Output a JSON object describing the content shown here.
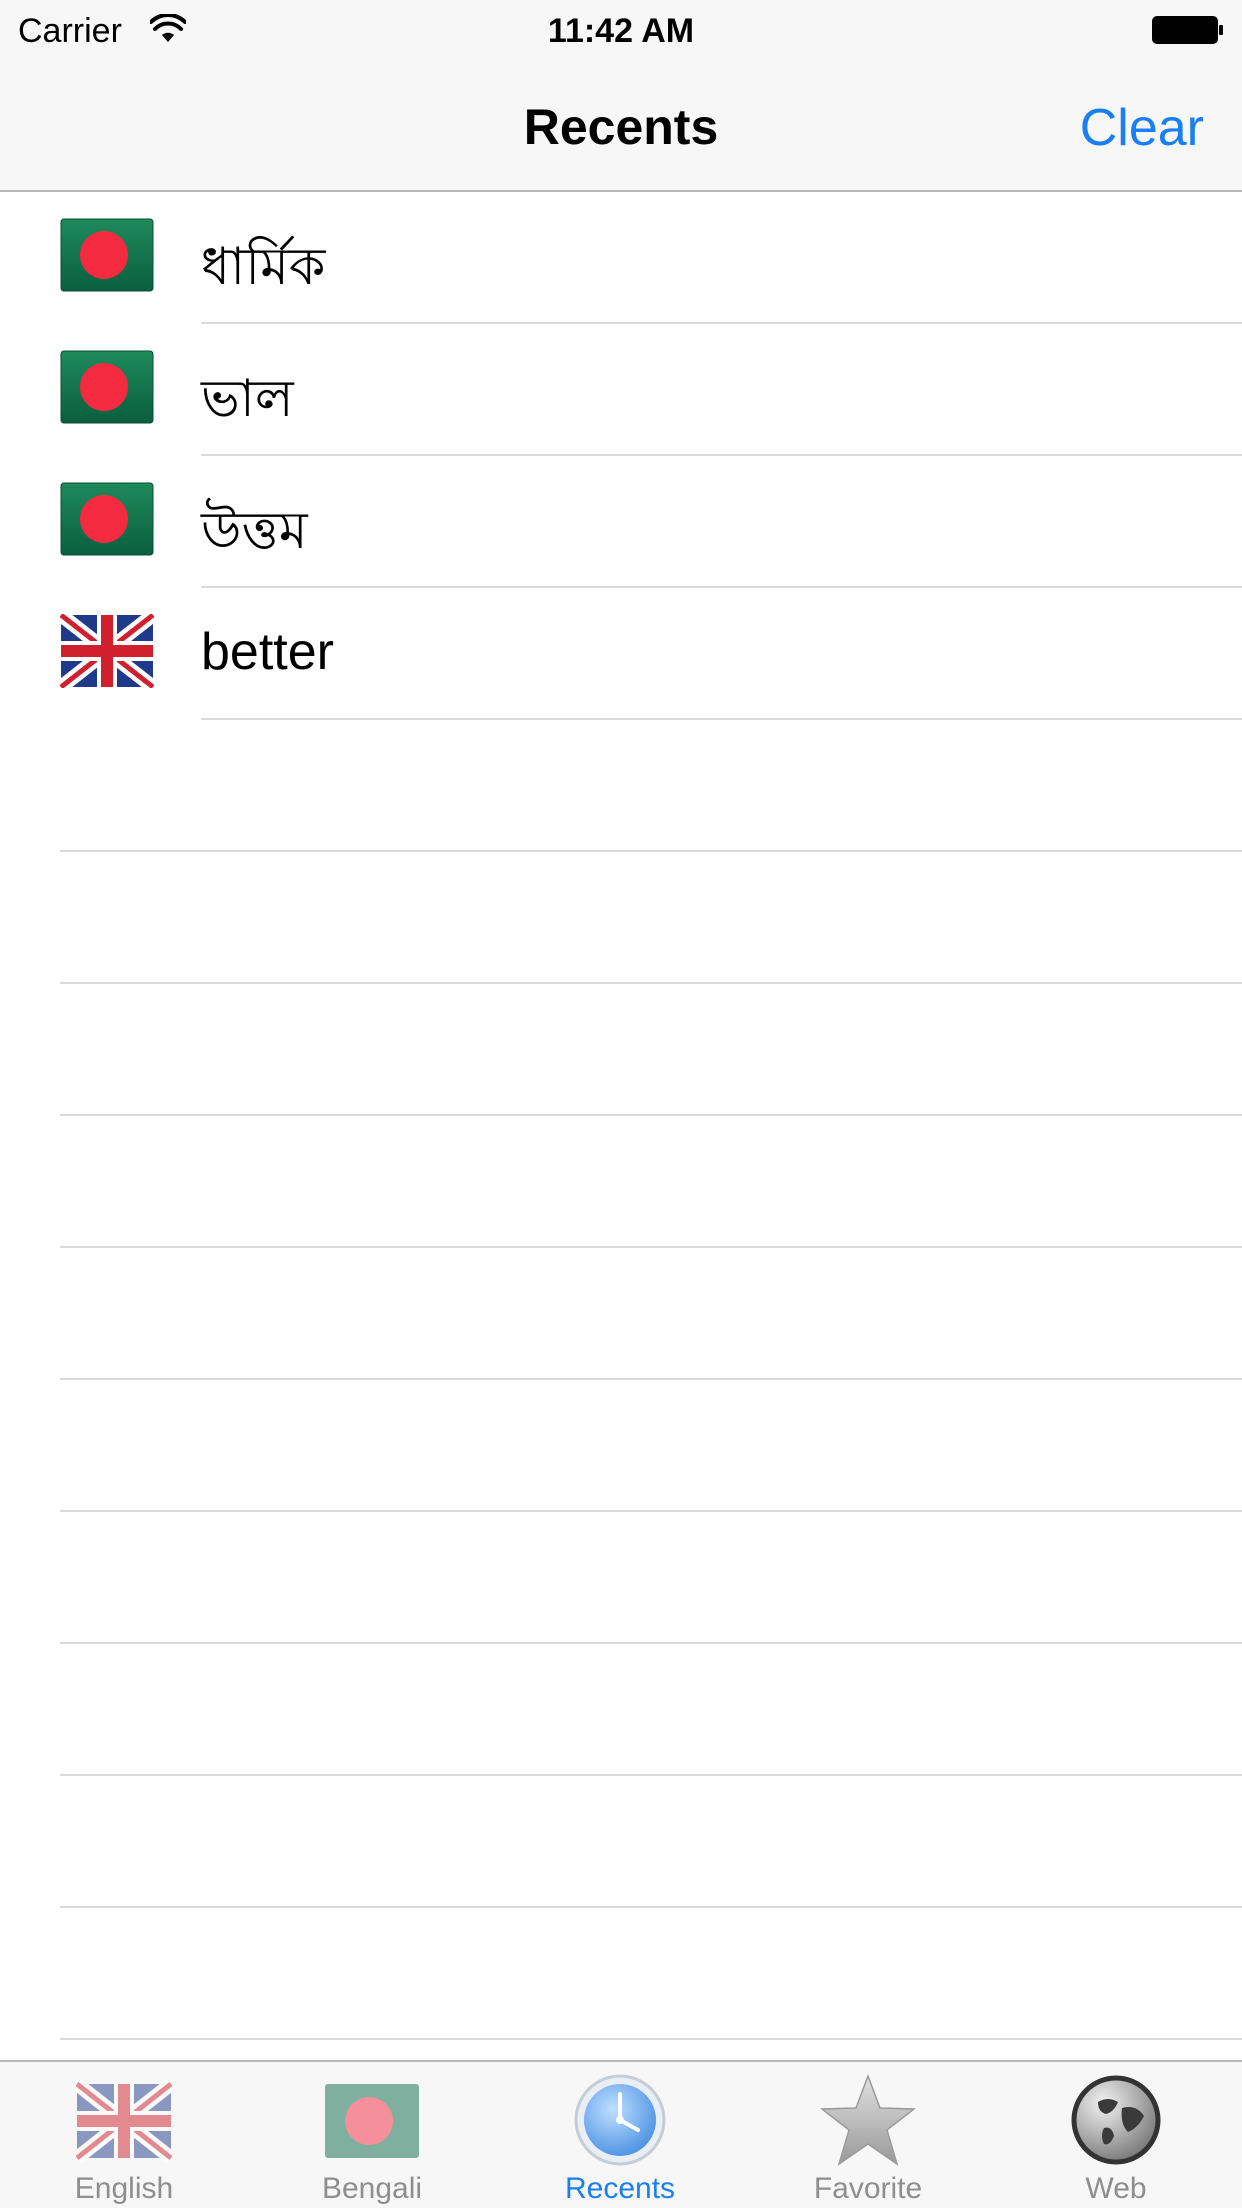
{
  "status_bar": {
    "carrier": "Carrier",
    "time": "11:42 AM"
  },
  "nav": {
    "title": "Recents",
    "clear_label": "Clear"
  },
  "recents": [
    {
      "word": "ধার্মিক",
      "flag": "bangladesh-flag-icon"
    },
    {
      "word": "ভাল",
      "flag": "bangladesh-flag-icon"
    },
    {
      "word": "উত্তম",
      "flag": "bangladesh-flag-icon"
    },
    {
      "word": "better",
      "flag": "uk-flag-icon"
    }
  ],
  "tabs": [
    {
      "label": "English",
      "icon": "uk-flag-icon",
      "active": false
    },
    {
      "label": "Bengali",
      "icon": "bangladesh-flag-icon",
      "active": false
    },
    {
      "label": "Recents",
      "icon": "clock-icon",
      "active": true
    },
    {
      "label": "Favorite",
      "icon": "star-icon",
      "active": false
    },
    {
      "label": "Web",
      "icon": "globe-icon",
      "active": false
    }
  ],
  "colors": {
    "accent": "#1a7ff0",
    "inactive_tab": "#8e8e8e",
    "bar_background": "#f7f7f7",
    "bangladesh_green": "#0a6a4a",
    "bangladesh_red": "#f42a41"
  }
}
